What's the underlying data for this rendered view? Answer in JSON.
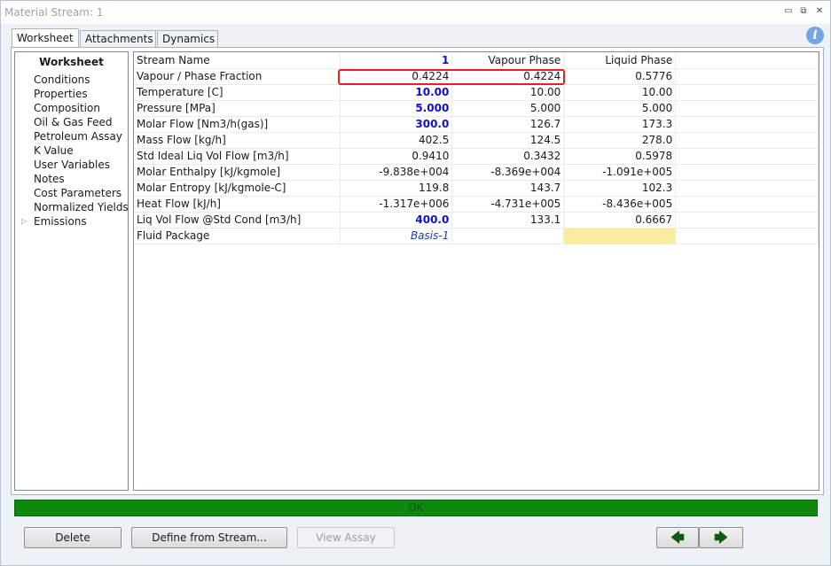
{
  "window": {
    "title": "Material Stream: 1"
  },
  "tabs": [
    "Worksheet",
    "Attachments",
    "Dynamics"
  ],
  "nav": {
    "header": "Worksheet",
    "items": [
      "Conditions",
      "Properties",
      "Composition",
      "Oil & Gas Feed",
      "Petroleum Assay",
      "K Value",
      "User Variables",
      "Notes",
      "Cost Parameters",
      "Normalized Yields",
      "Emissions"
    ]
  },
  "grid": {
    "rows": [
      {
        "label": "Stream Name",
        "c1": "1",
        "c2": "Vapour Phase",
        "c3": "Liquid Phase"
      },
      {
        "label": "Vapour / Phase Fraction",
        "c1": "0.4224",
        "c2": "0.4224",
        "c3": "0.5776"
      },
      {
        "label": "Temperature [C]",
        "c1": "10.00",
        "c2": "10.00",
        "c3": "10.00"
      },
      {
        "label": "Pressure [MPa]",
        "c1": "5.000",
        "c2": "5.000",
        "c3": "5.000"
      },
      {
        "label": "Molar Flow [Nm3/h(gas)]",
        "c1": "300.0",
        "c2": "126.7",
        "c3": "173.3"
      },
      {
        "label": "Mass Flow [kg/h]",
        "c1": "402.5",
        "c2": "124.5",
        "c3": "278.0"
      },
      {
        "label": "Std Ideal Liq Vol Flow [m3/h]",
        "c1": "0.9410",
        "c2": "0.3432",
        "c3": "0.5978"
      },
      {
        "label": "Molar Enthalpy [kJ/kgmole]",
        "c1": "-9.838e+004",
        "c2": "-8.369e+004",
        "c3": "-1.091e+005"
      },
      {
        "label": "Molar Entropy [kJ/kgmole-C]",
        "c1": "119.8",
        "c2": "143.7",
        "c3": "102.3"
      },
      {
        "label": "Heat Flow [kJ/h]",
        "c1": "-1.317e+006",
        "c2": "-4.731e+005",
        "c3": "-8.436e+005"
      },
      {
        "label": "Liq Vol Flow @Std Cond [m3/h]",
        "c1": "400.0",
        "c2": "133.1",
        "c3": "0.6667"
      },
      {
        "label": "Fluid Package",
        "c1": "Basis-1",
        "c2": "",
        "c3": ""
      }
    ]
  },
  "status": {
    "text": "OK",
    "color": "#0d8a0d"
  },
  "buttons": {
    "delete": "Delete",
    "define_from_stream": "Define from Stream...",
    "view_assay": "View Assay"
  }
}
